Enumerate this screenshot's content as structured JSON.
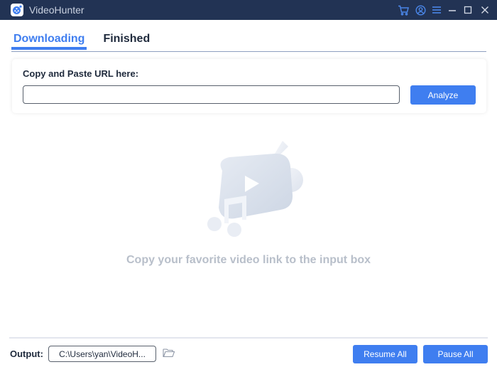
{
  "titlebar": {
    "app_title": "VideoHunter",
    "icons": [
      "cart-icon",
      "account-icon",
      "menu-icon",
      "minimize-icon",
      "maximize-icon",
      "close-icon"
    ]
  },
  "tabs": [
    {
      "label": "Downloading",
      "active": true
    },
    {
      "label": "Finished",
      "active": false
    }
  ],
  "url_card": {
    "label": "Copy and Paste URL here:",
    "input_value": "",
    "input_placeholder": "",
    "analyze_label": "Analyze"
  },
  "empty_state": {
    "illustration": "video-music-illustration",
    "message": "Copy your favorite video link to the input box"
  },
  "footer": {
    "output_label": "Output:",
    "output_path": "C:\\Users\\yan\\VideoH...",
    "resume_all_label": "Resume All",
    "pause_all_label": "Pause All"
  },
  "colors": {
    "titlebar_bg": "#223354",
    "accent": "#3f7ef0",
    "titlebar_icon": "#4a86e8"
  }
}
